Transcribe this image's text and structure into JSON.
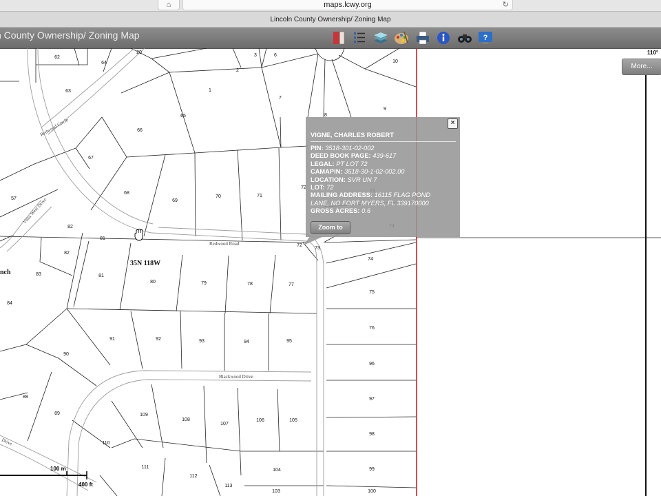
{
  "browser": {
    "url": "maps.lcwy.org",
    "tab_title": "Lincoln County Ownership/ Zoning Map"
  },
  "app": {
    "title": "n County Ownership/ Zoning Map",
    "toolbar": [
      "book-icon",
      "legend-list-icon",
      "layers-icon",
      "palette-icon",
      "print-icon",
      "info-icon",
      "binoculars-icon",
      "help-icon"
    ],
    "more_label": "More..."
  },
  "map": {
    "coord_label": "110°",
    "township_label": "35N 118W",
    "edge_label": "nch",
    "streets": {
      "redwood_circle": "Redwood Circle",
      "vista_west": "Vista West Drive",
      "redwood_road": "Redwood Road",
      "blackwood": "Blackwood Drive",
      "drive_sw": "Drive"
    },
    "scale": {
      "metric": "100 m",
      "imperial": "400 ft"
    },
    "colors": {
      "county_line": "#cc1f2b",
      "parcel_line": "#222222"
    },
    "lots": {
      "l62": "62",
      "l64": "64",
      "l20": "20",
      "l3": "3",
      "l6": "6",
      "l10": "10",
      "l2": "2",
      "l1": "1",
      "l63": "63",
      "l7": "7",
      "l65": "65",
      "l9": "9",
      "l8": "8",
      "l66": "66",
      "l67": "67",
      "l57": "57",
      "l68": "68",
      "l69": "69",
      "l70": "70",
      "l71": "71",
      "l72a": "72",
      "l72b": "72",
      "l74a": "74",
      "l82a": "82",
      "l81a": "81",
      "l72c": "72",
      "l73": "73",
      "l82b": "82",
      "l74b": "74",
      "l83": "83",
      "l81b": "81",
      "l80": "80",
      "l79": "79",
      "l78": "78",
      "l77": "77",
      "l75": "75",
      "l84": "84",
      "l76": "76",
      "l91": "91",
      "l92": "92",
      "l93": "93",
      "l94": "94",
      "l95": "95",
      "l90": "90",
      "l96": "96",
      "l88": "88",
      "l97": "97",
      "l89": "89",
      "l109": "109",
      "l108": "108",
      "l107": "107",
      "l106": "106",
      "l105": "105",
      "l98": "98",
      "l110": "110",
      "l111": "111",
      "l112": "112",
      "l113": "113",
      "l104": "104",
      "l99": "99",
      "l103": "103",
      "l100": "100"
    }
  },
  "popup": {
    "owner": "VIGNE, CHARLES ROBERT",
    "fields": [
      {
        "label": "PIN:",
        "value": "3518-301-02-002"
      },
      {
        "label": "DEED BOOK PAGE:",
        "value": "439-617"
      },
      {
        "label": "LEGAL:",
        "value": "PT LOT 72"
      },
      {
        "label": "CAMAPIN:",
        "value": "3518-30-1-02-002.00"
      },
      {
        "label": "LOCATION:",
        "value": "SVR UN 7"
      },
      {
        "label": "LOT:",
        "value": "72"
      },
      {
        "label": "MAILING ADDRESS:",
        "value": "16115 FLAG POND"
      },
      {
        "label": "",
        "value": "LANE, NO FORT MYERS, FL  339170000"
      },
      {
        "label": "GROSS ACRES:",
        "value": "0.6"
      }
    ],
    "close_label": "×",
    "zoom_label": "Zoom to"
  }
}
